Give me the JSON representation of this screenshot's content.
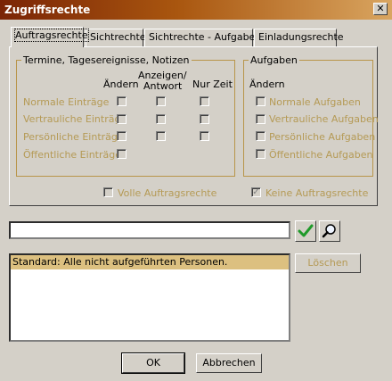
{
  "window": {
    "title": "Zugriffsrechte",
    "close_icon": "x-icon"
  },
  "tabs": [
    {
      "label": "Auftragsrechte",
      "active": true
    },
    {
      "label": "Sichtrechte"
    },
    {
      "label": "Sichtrechte - Aufgaben"
    },
    {
      "label": "Einladungsrechte"
    }
  ],
  "termine": {
    "group_label": "Termine, Tagesereignisse, Notizen",
    "col_aendern": "Ändern",
    "col_anzeigen_1": "Anzeigen/",
    "col_anzeigen_2": "Antwort",
    "col_nurzeit": "Nur Zeit",
    "rows": [
      {
        "label": "Normale Einträge"
      },
      {
        "label": "Vertrauliche Einträge"
      },
      {
        "label": "Persönliche Einträge"
      },
      {
        "label": "Öffentliche Einträge"
      }
    ]
  },
  "aufgaben": {
    "group_label": "Aufgaben",
    "col_aendern": "Ändern",
    "rows": [
      {
        "label": "Normale Aufgaben"
      },
      {
        "label": "Vertrauliche Aufgaben"
      },
      {
        "label": "Persönliche Aufgaben"
      },
      {
        "label": "Öffentliche Aufgaben"
      }
    ]
  },
  "volle_auftragsrechte": {
    "label": "Volle Auftragsrechte",
    "checked": false
  },
  "keine_auftragsrechte": {
    "label": "Keine Auftragsrechte",
    "checked": true
  },
  "person_input": {
    "value": ""
  },
  "confirm_icon": "checkmark-icon",
  "search_icon": "magnifier-icon",
  "list": {
    "items": [
      "Standard: Alle nicht aufgeführten Personen."
    ]
  },
  "buttons": {
    "loeschen": "Löschen",
    "ok": "OK",
    "abbrechen": "Abbrechen"
  }
}
